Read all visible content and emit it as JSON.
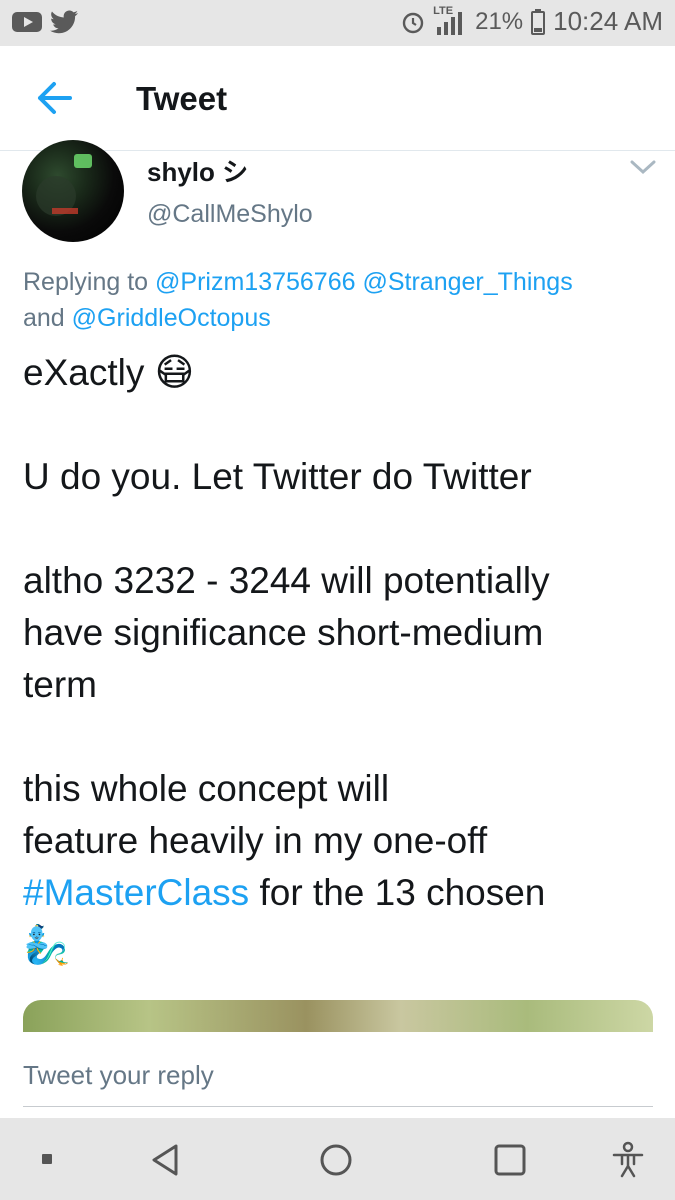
{
  "status_bar": {
    "lte": "LTE",
    "battery": "21%",
    "time": "10:24 AM",
    "icons": [
      "youtube-icon",
      "twitter-bird-icon",
      "alarm-icon",
      "signal-icon",
      "battery-icon"
    ]
  },
  "app_bar": {
    "title": "Tweet",
    "back_icon": "arrow-left-icon",
    "accent": "#1da1f2"
  },
  "tweet": {
    "display_name": "shylo シ",
    "handle": "@CallMeShylo",
    "replying_prefix": "Replying to",
    "mentions": [
      "@Prizm13756766",
      "@Stranger_Things",
      "@GriddleOctopus"
    ],
    "and_word": "and",
    "body": {
      "line1": "eXactly",
      "line1_emoji": "😷",
      "line2": "U do you. Let Twitter do Twitter",
      "line3a": "altho 3232 - 3244 will potentially",
      "line3b": "have significance short-medium",
      "line3c": "term",
      "line4a": "this whole concept will",
      "line4b": "feature heavily in my one-off",
      "hashtag": "#MasterClass",
      "line4c_rest": " for the 13 chosen",
      "end_emoji": "🧞‍♂️"
    }
  },
  "reply": {
    "placeholder": "Tweet your reply"
  },
  "nav_bar": {
    "buttons": [
      "recents-dot-icon",
      "back-triangle-icon",
      "home-circle-icon",
      "overview-square-icon",
      "accessibility-icon"
    ]
  }
}
